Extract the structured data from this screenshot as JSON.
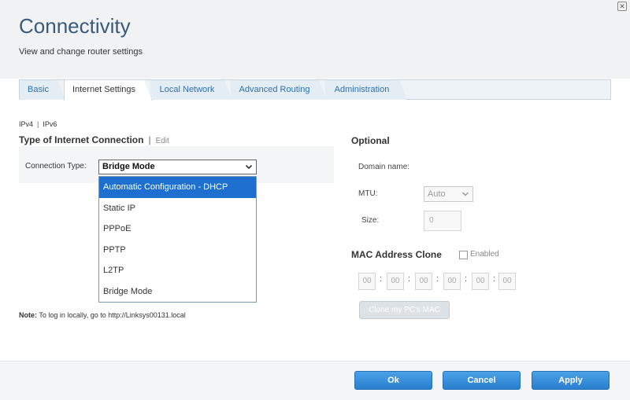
{
  "window": {
    "close_glyph": "✕"
  },
  "header": {
    "title": "Connectivity",
    "subtitle": "View and change router settings"
  },
  "tabs": [
    {
      "label": "Basic",
      "active": false
    },
    {
      "label": "Internet Settings",
      "active": true
    },
    {
      "label": "Local Network",
      "active": false
    },
    {
      "label": "Advanced Routing",
      "active": false
    },
    {
      "label": "Administration",
      "active": false
    }
  ],
  "ip_version": {
    "ipv4": "IPv4",
    "separator": "|",
    "ipv6": "IPv6"
  },
  "connection": {
    "section_title": "Type of Internet Connection",
    "separator": "|",
    "edit_label": "Edit",
    "type_label": "Connection Type:",
    "selected_value": "Bridge Mode",
    "chevron": "⌄",
    "options": [
      {
        "label": "Automatic Configuration - DHCP",
        "highlighted": true
      },
      {
        "label": "Static IP",
        "highlighted": false
      },
      {
        "label": "PPPoE",
        "highlighted": false
      },
      {
        "label": "PPTP",
        "highlighted": false
      },
      {
        "label": "L2TP",
        "highlighted": false
      },
      {
        "label": "Bridge Mode",
        "highlighted": false
      }
    ]
  },
  "note": {
    "prefix": "Note:",
    "text": " To log in locally, go to http://Linksys00131.local"
  },
  "optional": {
    "title": "Optional",
    "domain_label": "Domain name:",
    "mtu_label": "MTU:",
    "mtu_value": "Auto",
    "size_label": "Size:",
    "size_value": "0"
  },
  "mac_clone": {
    "title": "MAC Address Clone",
    "enabled_label": "Enabled",
    "octets": [
      "00",
      "00",
      "00",
      "00",
      "00",
      "00"
    ],
    "separator": ":",
    "clone_button": "Clone my PC's MAC"
  },
  "footer": {
    "ok_label": "Ok",
    "cancel_label": "Cancel",
    "apply_label": "Apply"
  },
  "colors": {
    "accent": "#2a7fcf",
    "title": "#3a5a7a",
    "dropdown_highlight": "#1f6fd1",
    "tab_text": "#2a6fb5"
  }
}
